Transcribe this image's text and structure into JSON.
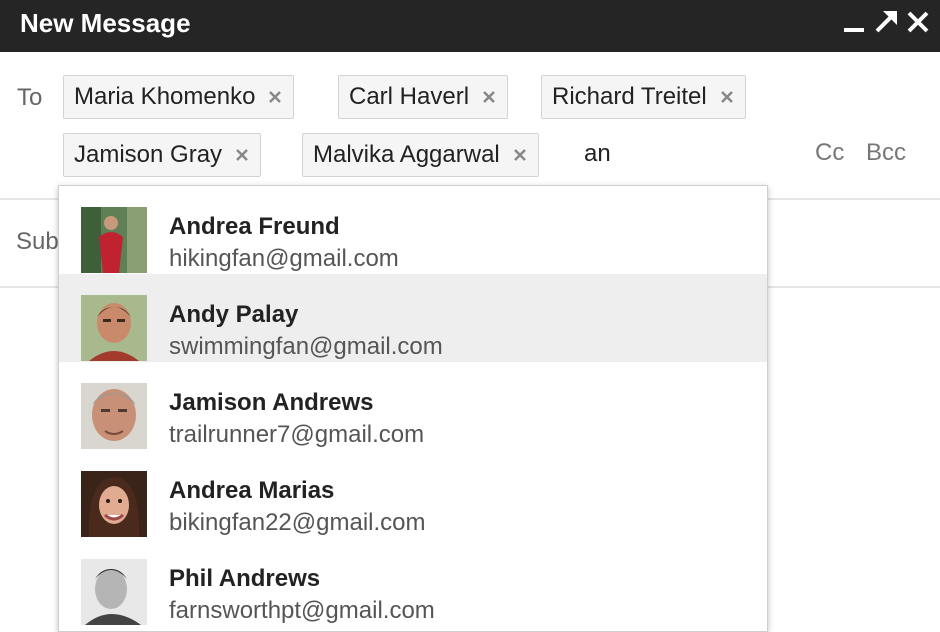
{
  "window": {
    "title": "New Message",
    "controls": [
      "minimize-icon",
      "pop-out-icon",
      "close-icon"
    ]
  },
  "compose": {
    "to_label": "To",
    "recipients": [
      {
        "name": "Maria Khomenko"
      },
      {
        "name": "Carl Haverl"
      },
      {
        "name": "Richard Treitel"
      },
      {
        "name": "Jamison Gray"
      },
      {
        "name": "Malvika Aggarwal"
      }
    ],
    "typed_text": "an",
    "cc_label": "Cc",
    "bcc_label": "Bcc",
    "subject_label": "Sub"
  },
  "autocomplete": {
    "selected_index": 1,
    "items": [
      {
        "name": "Andrea Freund",
        "email": "hikingfan@gmail.com"
      },
      {
        "name": "Andy Palay",
        "email": "swimmingfan@gmail.com"
      },
      {
        "name": "Jamison Andrews",
        "email": "trailrunner7@gmail.com"
      },
      {
        "name": "Andrea Marias",
        "email": "bikingfan22@gmail.com"
      },
      {
        "name": "Phil Andrews",
        "email": "farnsworthpt@gmail.com"
      }
    ]
  },
  "colors": {
    "titlebar": "#252525",
    "chip_bg": "#f5f5f5",
    "selected_bg": "#eeeeee"
  }
}
